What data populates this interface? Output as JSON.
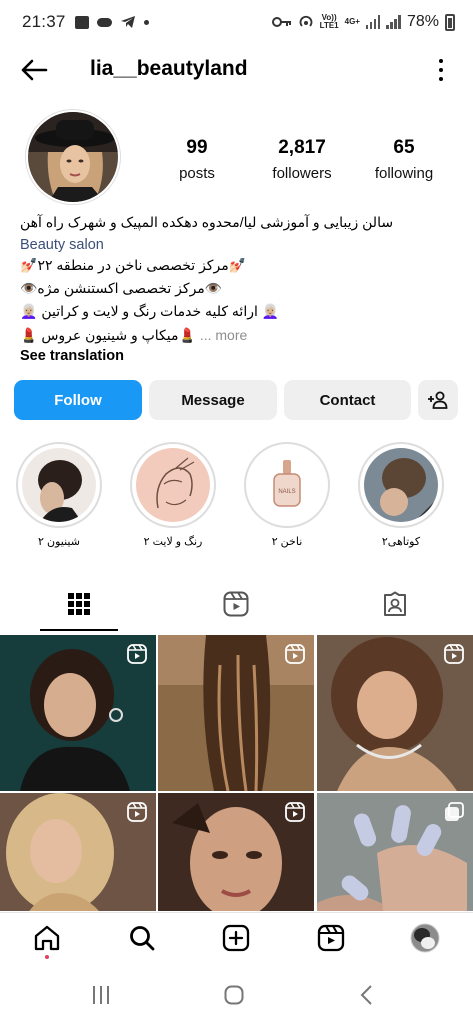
{
  "status_bar": {
    "time": "21:37",
    "net1": "Vo))",
    "net2": "LTE1",
    "net3": "4G+",
    "battery": "78%"
  },
  "header": {
    "username": "lia__beautyland"
  },
  "profile": {
    "posts_count": "99",
    "posts_label": "posts",
    "followers_count": "2,817",
    "followers_label": "followers",
    "following_count": "65",
    "following_label": "following"
  },
  "bio": {
    "line1": "سالن زیبایی و آموزشی لیا/محدوه دهکده المپیک و شهرک راه آهن",
    "category": "Beauty salon",
    "line2": "💅🏻مرکز تخصصی ناخن در منطقه ۲۲💅🏻",
    "line3": "👁️مرکز تخصصی اکستنشن مژه👁️",
    "line4": "👩🏼‍🦳 ارائه کلیه خدمات رنگ و لایت و کراتین 👩🏼‍🦳",
    "line5": "💄میکاپ و شینیون عروس 💄",
    "more": "... more",
    "see_translation": "See translation"
  },
  "actions": {
    "follow": "Follow",
    "message": "Message",
    "contact": "Contact"
  },
  "highlights": [
    {
      "label": "شینیون ۲"
    },
    {
      "label": "رنگ و لایت ۲"
    },
    {
      "label": "ناخن ۲"
    },
    {
      "label": "کوتاهی۲"
    }
  ],
  "nail_bottle_text": "NAILS",
  "icons": {
    "back": "arrow-left-icon",
    "menu": "more-vertical-icon",
    "add_user": "person-add-icon",
    "grid": "grid-icon",
    "reels": "reels-icon",
    "tagged": "tagged-icon",
    "home": "home-icon",
    "search": "search-icon",
    "create": "plus-square-icon",
    "nav_reels": "reels-icon"
  },
  "colors": {
    "follow_button": "#1a98f5",
    "secondary_button": "#efefef",
    "category_link": "#3b4f78",
    "muted": "#8e8e8e"
  }
}
